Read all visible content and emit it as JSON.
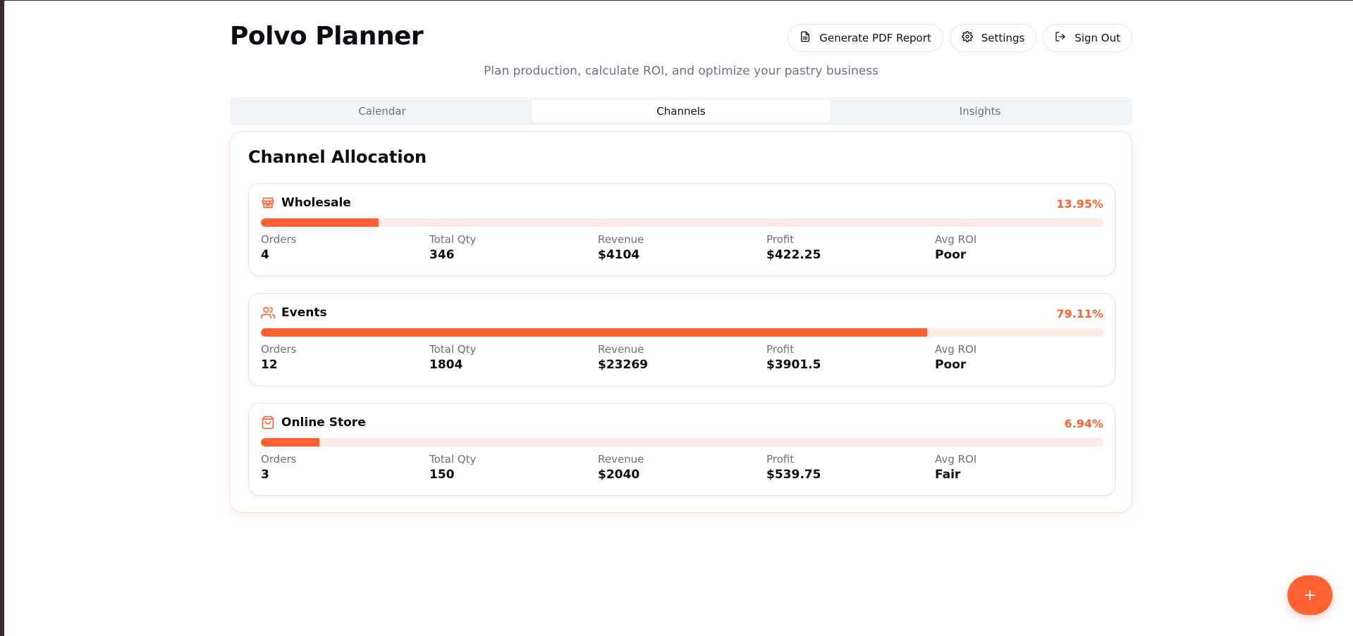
{
  "app": {
    "title": "Polvo Planner",
    "subtitle": "Plan production, calculate ROI, and optimize your pastry business"
  },
  "header": {
    "pdf_label": "Generate PDF Report",
    "settings_label": "Settings",
    "signout_label": "Sign Out"
  },
  "tabs": [
    {
      "label": "Calendar",
      "active": false
    },
    {
      "label": "Channels",
      "active": true
    },
    {
      "label": "Insights",
      "active": false
    }
  ],
  "allocation": {
    "title": "Channel Allocation",
    "accent_color": "#ff6133",
    "stat_labels": [
      "Orders",
      "Total Qty",
      "Revenue",
      "Profit",
      "Avg ROI"
    ],
    "channels": [
      {
        "name": "Wholesale",
        "icon": "store-icon",
        "percent_label": "13.95%",
        "percent": 13.95,
        "orders": "4",
        "total_qty": "346",
        "revenue": "$4104",
        "profit": "$422.25",
        "avg_roi": "Poor"
      },
      {
        "name": "Events",
        "icon": "users-icon",
        "percent_label": "79.11%",
        "percent": 79.11,
        "orders": "12",
        "total_qty": "1804",
        "revenue": "$23269",
        "profit": "$3901.5",
        "avg_roi": "Poor"
      },
      {
        "name": "Online Store",
        "icon": "shopping-bag-icon",
        "percent_label": "6.94%",
        "percent": 6.94,
        "orders": "3",
        "total_qty": "150",
        "revenue": "$2040",
        "profit": "$539.75",
        "avg_roi": "Fair"
      }
    ]
  },
  "fab": {
    "label": "+"
  }
}
